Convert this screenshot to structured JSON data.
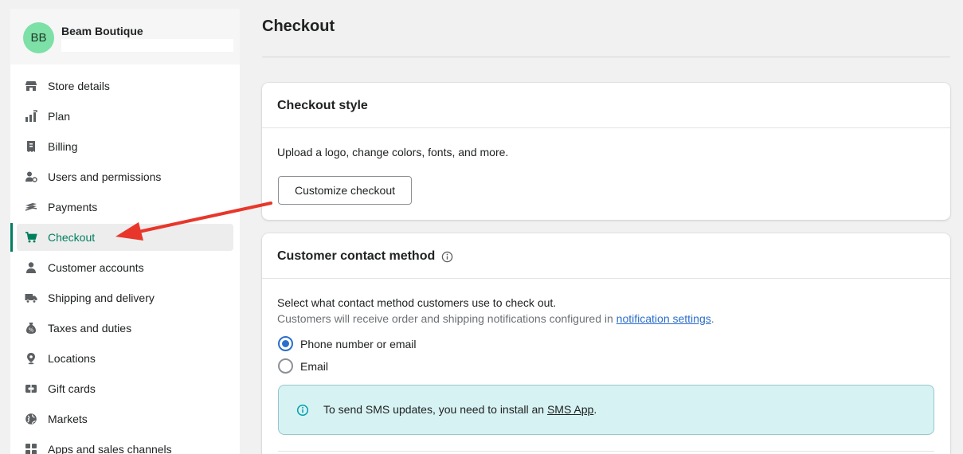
{
  "store": {
    "initials": "BB",
    "name": "Beam Boutique"
  },
  "nav": {
    "items": [
      {
        "label": "Store details",
        "icon": "store-icon"
      },
      {
        "label": "Plan",
        "icon": "plan-icon"
      },
      {
        "label": "Billing",
        "icon": "billing-icon"
      },
      {
        "label": "Users and permissions",
        "icon": "users-icon"
      },
      {
        "label": "Payments",
        "icon": "payments-icon"
      },
      {
        "label": "Checkout",
        "icon": "cart-icon",
        "active": true
      },
      {
        "label": "Customer accounts",
        "icon": "person-icon"
      },
      {
        "label": "Shipping and delivery",
        "icon": "truck-icon"
      },
      {
        "label": "Taxes and duties",
        "icon": "taxes-icon"
      },
      {
        "label": "Locations",
        "icon": "location-icon"
      },
      {
        "label": "Gift cards",
        "icon": "gift-card-icon"
      },
      {
        "label": "Markets",
        "icon": "globe-icon"
      },
      {
        "label": "Apps and sales channels",
        "icon": "apps-icon"
      }
    ]
  },
  "page": {
    "title": "Checkout"
  },
  "checkout_style": {
    "title": "Checkout style",
    "description": "Upload a logo, change colors, fonts, and more.",
    "button_label": "Customize checkout"
  },
  "contact_method": {
    "title": "Customer contact method",
    "description": "Select what contact method customers use to check out.",
    "note_prefix": "Customers will receive order and shipping notifications configured in ",
    "note_link": "notification settings",
    "note_suffix": ".",
    "options": [
      {
        "label": "Phone number or email",
        "checked": true
      },
      {
        "label": "Email",
        "checked": false
      }
    ],
    "banner_prefix": "To send SMS updates, you need to install an ",
    "banner_link": "SMS App",
    "banner_suffix": "."
  },
  "colors": {
    "accent_green": "#007f5f",
    "link_blue": "#2c6ecb",
    "avatar": "#7de0a6",
    "banner_bg": "#d7f2f2",
    "annotation_arrow": "#e8362b"
  }
}
